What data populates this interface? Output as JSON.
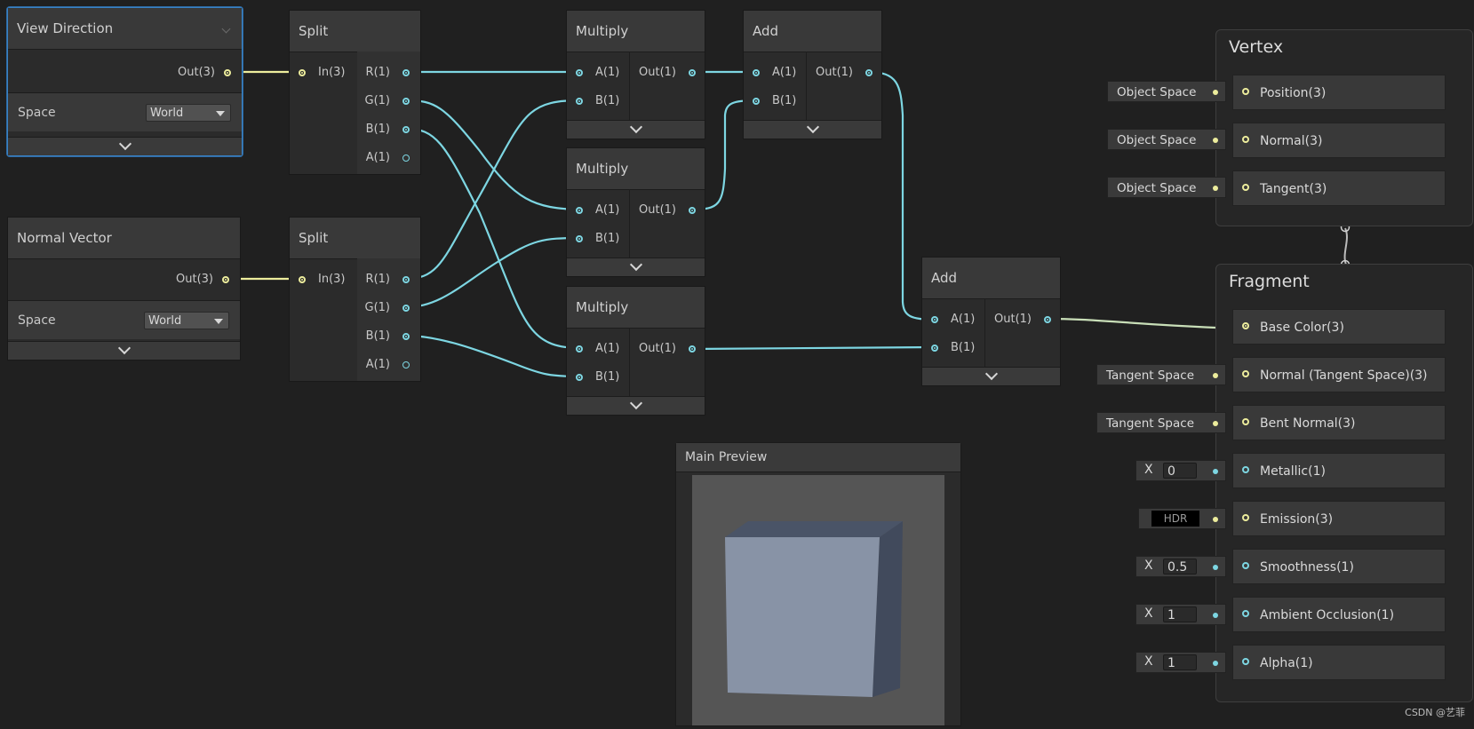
{
  "nodes": {
    "view_direction": {
      "title": "View Direction",
      "out": "Out(3)",
      "space_label": "Space",
      "space_value": "World"
    },
    "normal_vector": {
      "title": "Normal Vector",
      "out": "Out(3)",
      "space_label": "Space",
      "space_value": "World"
    },
    "split1": {
      "title": "Split",
      "in": "In(3)",
      "outs": [
        "R(1)",
        "G(1)",
        "B(1)",
        "A(1)"
      ]
    },
    "split2": {
      "title": "Split",
      "in": "In(3)",
      "outs": [
        "R(1)",
        "G(1)",
        "B(1)",
        "A(1)"
      ]
    },
    "multiply1": {
      "title": "Multiply",
      "a": "A(1)",
      "b": "B(1)",
      "out": "Out(1)"
    },
    "multiply2": {
      "title": "Multiply",
      "a": "A(1)",
      "b": "B(1)",
      "out": "Out(1)"
    },
    "multiply3": {
      "title": "Multiply",
      "a": "A(1)",
      "b": "B(1)",
      "out": "Out(1)"
    },
    "add1": {
      "title": "Add",
      "a": "A(1)",
      "b": "B(1)",
      "out": "Out(1)"
    },
    "add2": {
      "title": "Add",
      "a": "A(1)",
      "b": "B(1)",
      "out": "Out(1)"
    }
  },
  "vertex": {
    "title": "Vertex",
    "slots": [
      {
        "label": "Position(3)",
        "tag": "Object Space"
      },
      {
        "label": "Normal(3)",
        "tag": "Object Space"
      },
      {
        "label": "Tangent(3)",
        "tag": "Object Space"
      }
    ]
  },
  "fragment": {
    "title": "Fragment",
    "slots": [
      {
        "label": "Base Color(3)"
      },
      {
        "label": "Normal (Tangent Space)(3)",
        "tag": "Tangent Space"
      },
      {
        "label": "Bent Normal(3)",
        "tag": "Tangent Space"
      },
      {
        "label": "Metallic(1)",
        "x_label": "X",
        "value": "0"
      },
      {
        "label": "Emission(3)",
        "hdr": "HDR"
      },
      {
        "label": "Smoothness(1)",
        "x_label": "X",
        "value": "0.5"
      },
      {
        "label": "Ambient Occlusion(1)",
        "x_label": "X",
        "value": "1"
      },
      {
        "label": "Alpha(1)",
        "x_label": "X",
        "value": "1"
      }
    ]
  },
  "preview": {
    "title": "Main Preview"
  },
  "watermark": "CSDN @艺菲",
  "colors": {
    "float_wire": "#7dd6e2",
    "vector_wire": "#ecec9c",
    "selection": "#3a82c4",
    "cube_front": "#8893a6",
    "cube_side": "#414a5c",
    "cube_top": "#4a5467"
  }
}
